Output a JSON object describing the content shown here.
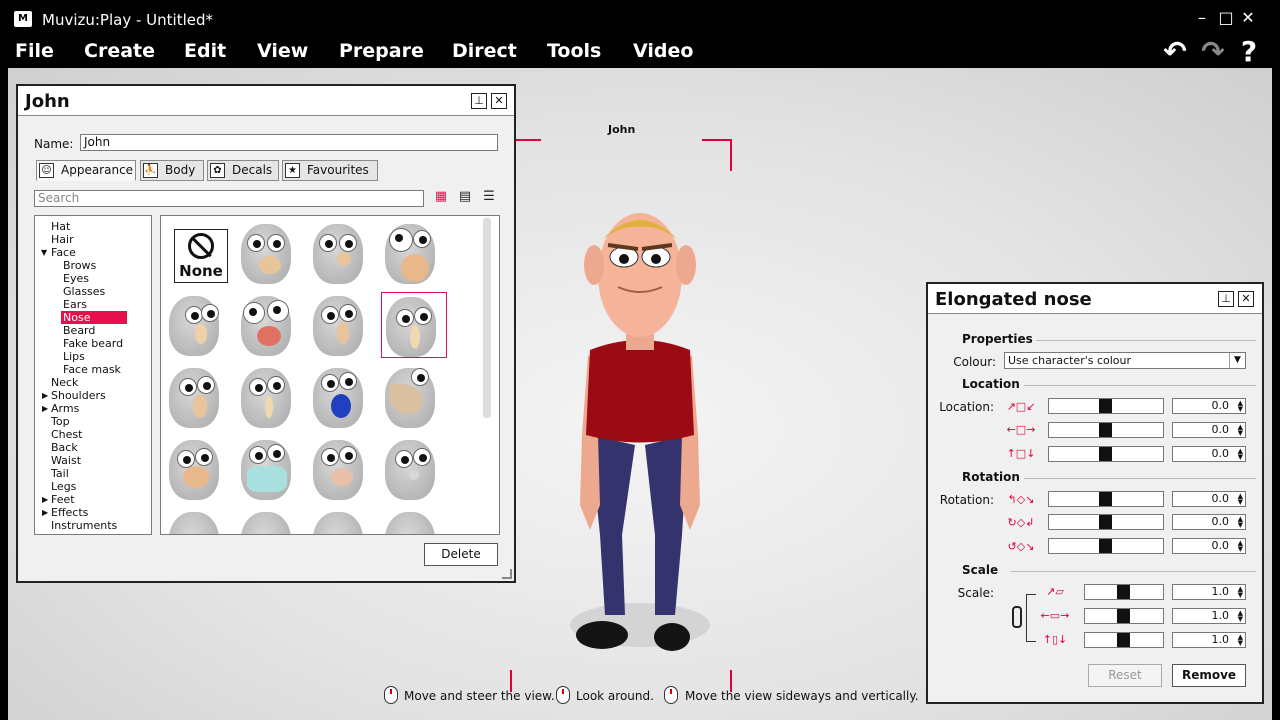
{
  "window": {
    "title": "Muvizu:Play - Untitled*",
    "app_icon": "M",
    "min_glyph": "–",
    "max_glyph": "□",
    "close_glyph": "✕"
  },
  "menu": [
    "File",
    "Create",
    "Edit",
    "View",
    "Prepare",
    "Direct",
    "Tools",
    "Video"
  ],
  "toolbar": {
    "undo_glyph": "↶",
    "redo_glyph": "↷",
    "help_glyph": "?"
  },
  "viewport": {
    "character_label": "John",
    "hints": [
      "Move and steer the view.",
      "Look around.",
      "Move the view sideways and vertically."
    ]
  },
  "character_panel": {
    "title": "John",
    "pin_glyph": "⊥",
    "close_glyph": "✕",
    "name_label": "Name:",
    "name_value": "John",
    "tabs": [
      "Appearance",
      "Body",
      "Decals",
      "Favourites"
    ],
    "search_placeholder": "Search",
    "tree": [
      "Hat",
      "Hair",
      "Face",
      "Brows",
      "Eyes",
      "Glasses",
      "Ears",
      "Nose",
      "Beard",
      "Fake beard",
      "Lips",
      "Face mask",
      "Neck",
      "Shoulders",
      "Arms",
      "Top",
      "Chest",
      "Back",
      "Waist",
      "Tail",
      "Legs",
      "Feet",
      "Effects",
      "Instruments"
    ],
    "selected_item": "Nose",
    "none_label": "None",
    "delete_label": "Delete"
  },
  "nose_panel": {
    "title": "Elongated nose",
    "pin_glyph": "⊥",
    "close_glyph": "✕",
    "properties_head": "Properties",
    "colour_label": "Colour:",
    "colour_value": "Use character's colour",
    "location_head": "Location",
    "location_label": "Location:",
    "location_values": [
      "0.0",
      "0.0",
      "0.0"
    ],
    "rotation_head": "Rotation",
    "rotation_label": "Rotation:",
    "rotation_values": [
      "0.0",
      "0.0",
      "0.0"
    ],
    "scale_head": "Scale",
    "scale_label": "Scale:",
    "scale_values": [
      "1.0",
      "1.0",
      "1.0"
    ],
    "reset_label": "Reset",
    "remove_label": "Remove"
  },
  "colors": {
    "accent": "#e8104c",
    "frame_marker": "#e0003a"
  }
}
